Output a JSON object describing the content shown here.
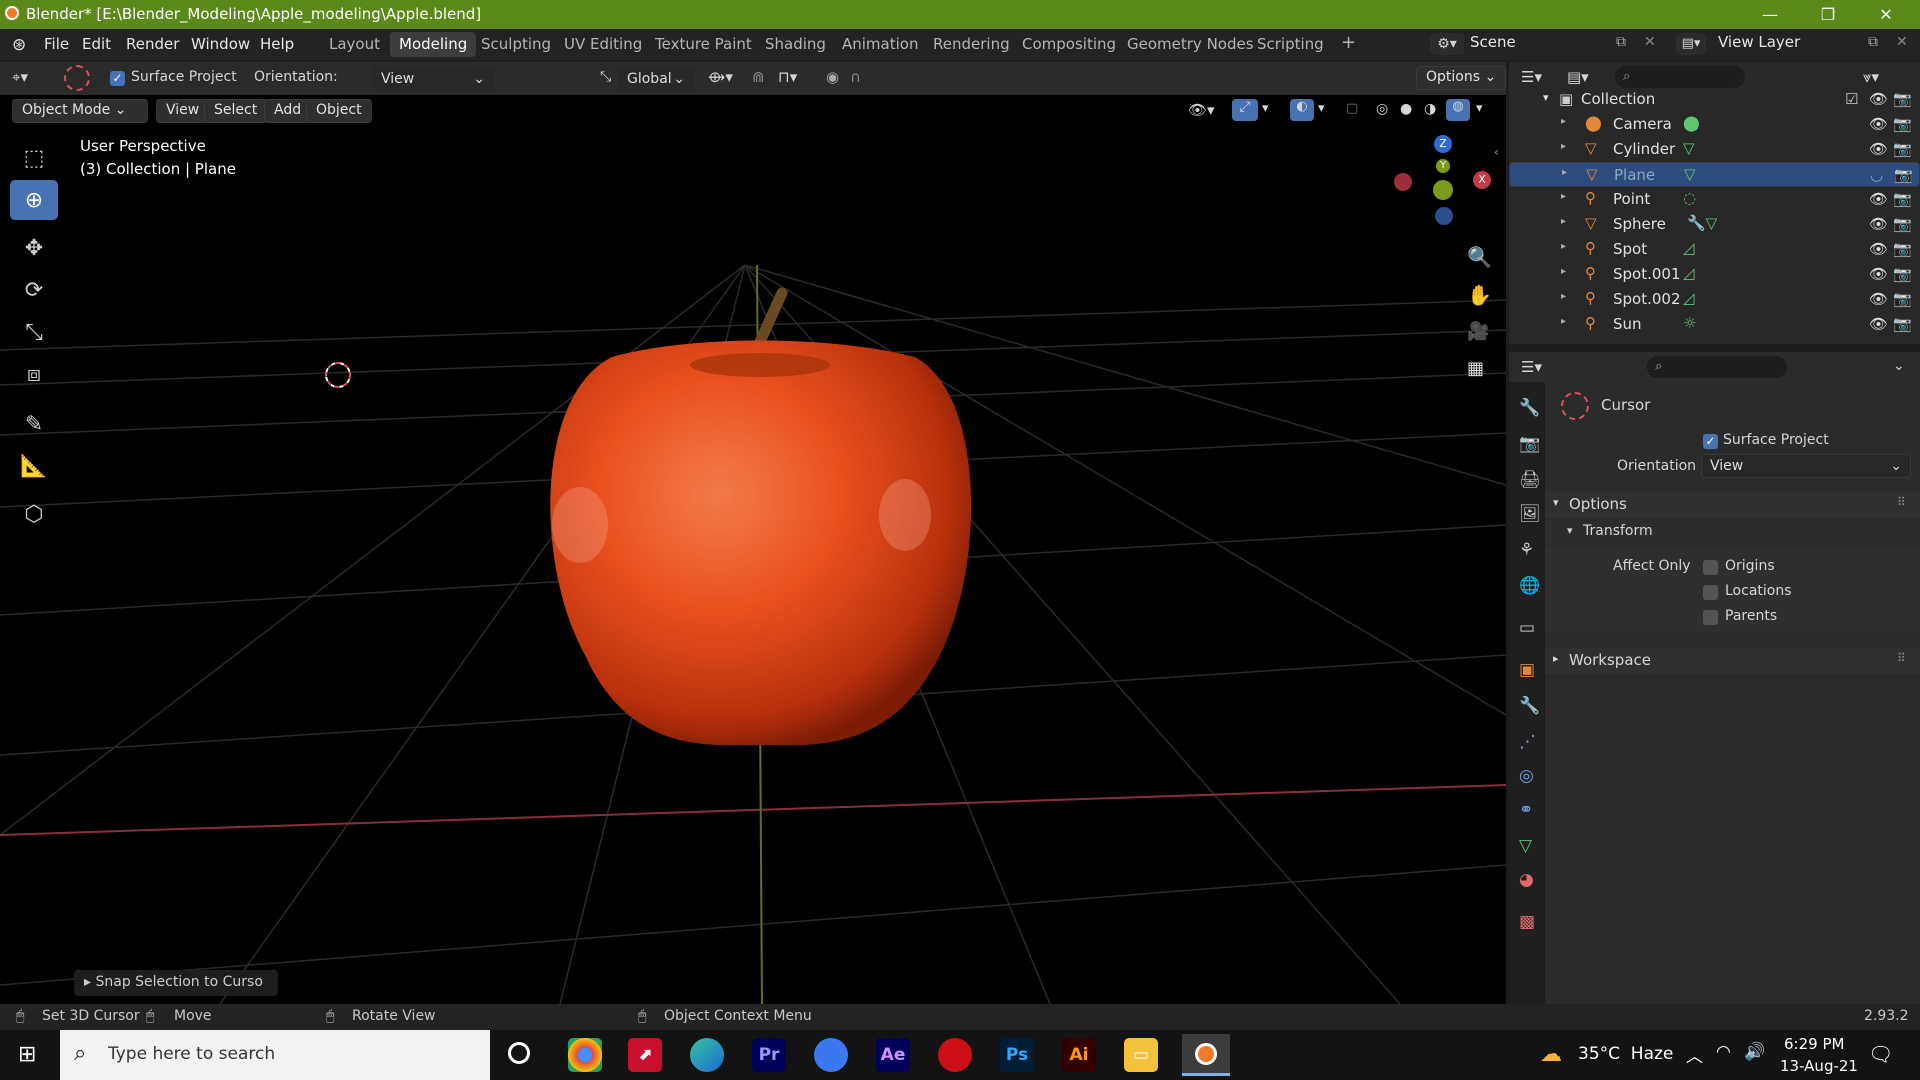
{
  "window": {
    "title": "Blender* [E:\\Blender_Modeling\\Apple_modeling\\Apple.blend]",
    "minimize": "—",
    "maximize": "❐",
    "close": "✕"
  },
  "menu": [
    "File",
    "Edit",
    "Render",
    "Window",
    "Help"
  ],
  "workspaces": [
    "Layout",
    "Modeling",
    "Sculpting",
    "UV Editing",
    "Texture Paint",
    "Shading",
    "Animation",
    "Rendering",
    "Compositing",
    "Geometry Nodes",
    "Scripting",
    "+"
  ],
  "active_workspace": "Modeling",
  "scene": "Scene",
  "view_layer": "View Layer",
  "tool_header": {
    "surface_project": "Surface Project",
    "orientation_label": "Orientation:",
    "orientation_value": "View",
    "transform_orientation": "Global",
    "options": "Options"
  },
  "view_header": {
    "mode": "Object Mode",
    "menus": [
      "View",
      "Select",
      "Add",
      "Object"
    ]
  },
  "viewport": {
    "info_line1": "User Perspective",
    "info_line2": "(3) Collection | Plane",
    "last_op": "Snap Selection to Curso",
    "gizmo": {
      "x": "X",
      "y": "Y",
      "z": "Z"
    }
  },
  "outliner": {
    "collection": "Collection",
    "items": [
      {
        "name": "Camera",
        "icon": "camera-data-icon"
      },
      {
        "name": "Cylinder",
        "icon": "mesh-data-icon"
      },
      {
        "name": "Plane",
        "icon": "mesh-data-icon",
        "selected": true
      },
      {
        "name": "Point",
        "icon": "light-point-icon"
      },
      {
        "name": "Sphere",
        "icon": "modifier-mesh-icon"
      },
      {
        "name": "Spot",
        "icon": "light-spot-icon"
      },
      {
        "name": "Spot.001",
        "icon": "light-spot-icon"
      },
      {
        "name": "Spot.002",
        "icon": "light-spot-icon"
      },
      {
        "name": "Sun",
        "icon": "light-sun-icon"
      }
    ]
  },
  "properties": {
    "tool_name": "Cursor",
    "surface_project": "Surface Project",
    "orientation_label": "Orientation",
    "orientation_value": "View",
    "options_panel": "Options",
    "transform_panel": "Transform",
    "affect_only": "Affect Only",
    "origins": "Origins",
    "locations": "Locations",
    "parents": "Parents",
    "workspace_panel": "Workspace"
  },
  "statusbar": {
    "left": "Set 3D Cursor",
    "move": "Move",
    "rotate": "Rotate View",
    "context": "Object Context Menu",
    "version": "2.93.2"
  },
  "taskbar": {
    "search_placeholder": "Type here to search",
    "weather": "35°C  Haze",
    "time": "6:29 PM",
    "date": "13-Aug-21",
    "apps": [
      "Pr",
      "Ae",
      "Ps",
      "Ai"
    ]
  },
  "colors": {
    "title_green": "#5c8a1a",
    "accent_blue": "#4772b3",
    "apple": "#e9501f",
    "axis_red": "#c43a48",
    "axis_green": "#7a9b1b"
  }
}
